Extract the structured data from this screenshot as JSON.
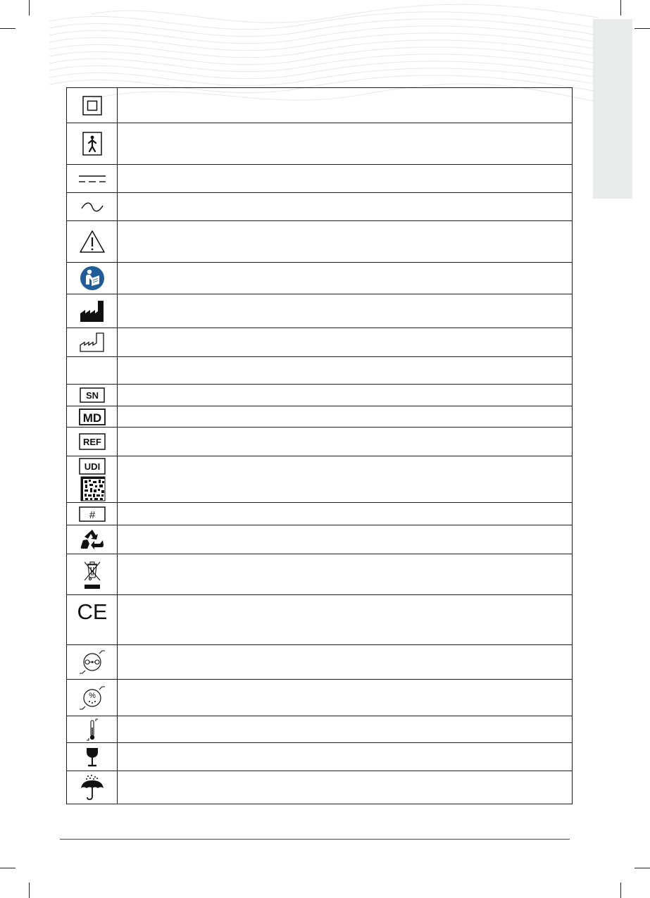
{
  "document": {
    "theme_colors": {
      "line": "#1a1a1a",
      "side_tab": "#e9eaea",
      "symbol_blue": "#1f5c99"
    },
    "symbols": [
      {
        "icon": "class-ii-double-square-icon",
        "description": ""
      },
      {
        "icon": "type-bf-applied-part-icon",
        "description": ""
      },
      {
        "icon": "direct-current-icon",
        "description": ""
      },
      {
        "icon": "alternating-current-icon",
        "description": ""
      },
      {
        "icon": "warning-triangle-icon",
        "description": ""
      },
      {
        "icon": "read-manual-icon",
        "description": ""
      },
      {
        "icon": "manufacturer-icon",
        "description": ""
      },
      {
        "icon": "date-of-manufacture-icon",
        "description": ""
      },
      {
        "icon": "",
        "description": ""
      },
      {
        "icon": "serial-number-icon",
        "label": "SN",
        "description": ""
      },
      {
        "icon": "medical-device-icon",
        "label": "MD",
        "description": ""
      },
      {
        "icon": "catalogue-number-icon",
        "label": "REF",
        "description": ""
      },
      {
        "icon": "udi-code-icon",
        "label": "UDI",
        "description": ""
      },
      {
        "icon": "model-number-icon",
        "label": "#",
        "description": ""
      },
      {
        "icon": "recycle-icon",
        "description": ""
      },
      {
        "icon": "weee-crossed-bin-icon",
        "description": ""
      },
      {
        "icon": "ce-mark-icon",
        "label": "CE",
        "description": ""
      },
      {
        "icon": "atmospheric-pressure-limit-icon",
        "description": ""
      },
      {
        "icon": "humidity-limit-icon",
        "label": "%",
        "description": ""
      },
      {
        "icon": "temperature-limit-icon",
        "description": ""
      },
      {
        "icon": "fragile-icon",
        "description": ""
      },
      {
        "icon": "keep-dry-icon",
        "description": ""
      }
    ]
  }
}
